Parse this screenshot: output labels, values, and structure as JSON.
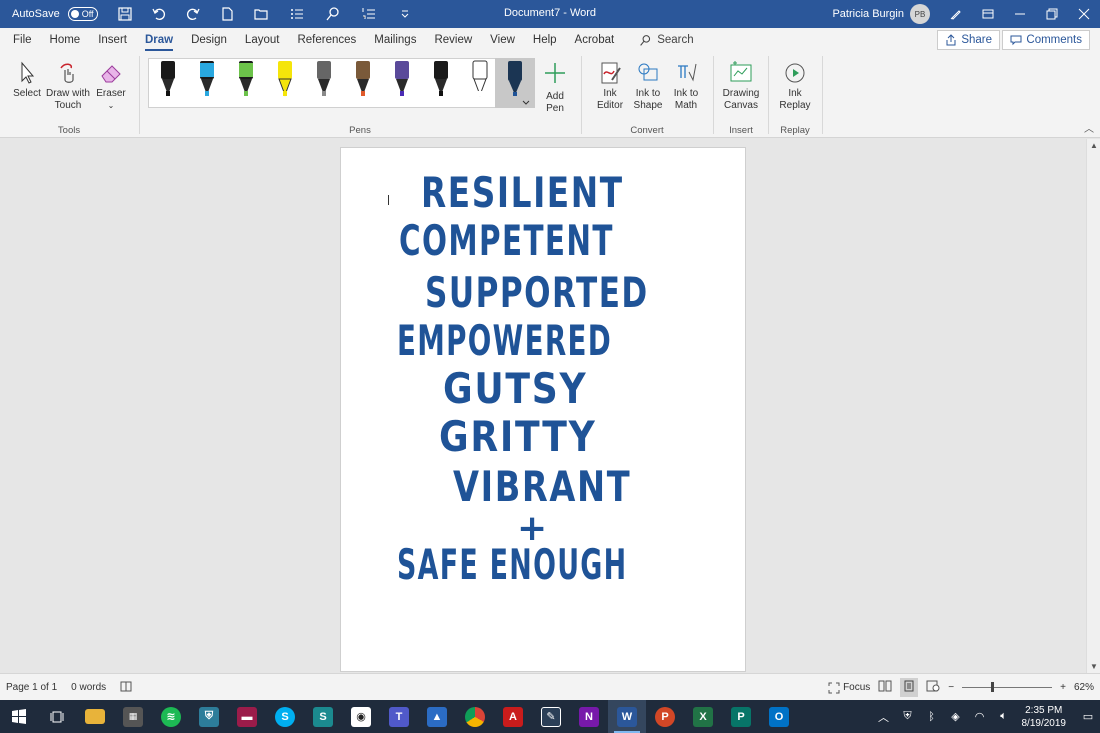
{
  "titlebar": {
    "autosave_label": "AutoSave",
    "autosave_state": "Off",
    "doc_title": "Document7  -  Word",
    "user_name": "Patricia Burgin",
    "user_initials": "PB"
  },
  "tabs": [
    {
      "label": "File"
    },
    {
      "label": "Home"
    },
    {
      "label": "Insert"
    },
    {
      "label": "Draw"
    },
    {
      "label": "Design"
    },
    {
      "label": "Layout"
    },
    {
      "label": "References"
    },
    {
      "label": "Mailings"
    },
    {
      "label": "Review"
    },
    {
      "label": "View"
    },
    {
      "label": "Help"
    },
    {
      "label": "Acrobat"
    }
  ],
  "active_tab": "Draw",
  "search_label": "Search",
  "share_label": "Share",
  "comments_label": "Comments",
  "ribbon": {
    "tools": {
      "group_label": "Tools",
      "select": "Select",
      "draw_touch_1": "Draw with",
      "draw_touch_2": "Touch",
      "eraser": "Eraser"
    },
    "pens": {
      "group_label": "Pens",
      "add_pen_1": "Add",
      "add_pen_2": "Pen",
      "colors": [
        "#111111",
        "#29a8e0",
        "#6cc24a",
        "#f5e50a",
        "#8a8a8a",
        "#e05a2b",
        "#4a2bb5",
        "#111111",
        "#ffffff",
        "#1f5397"
      ]
    },
    "convert": {
      "group_label": "Convert",
      "ink_editor_1": "Ink",
      "ink_editor_2": "Editor",
      "ink_shape_1": "Ink to",
      "ink_shape_2": "Shape",
      "ink_math_1": "Ink to",
      "ink_math_2": "Math"
    },
    "insert": {
      "group_label": "Insert",
      "canvas_1": "Drawing",
      "canvas_2": "Canvas"
    },
    "replay": {
      "group_label": "Replay",
      "ink_replay_1": "Ink",
      "ink_replay_2": "Replay"
    }
  },
  "document": {
    "ink_color": "#1f5397",
    "words": [
      "RESILIENT",
      "COMPETENT",
      "SUPPORTED",
      "EMPOWERED",
      "GUTSY",
      "GRITTY",
      "VIBRANT",
      "+",
      "SAFE ENOUGH"
    ]
  },
  "statusbar": {
    "page": "Page 1 of 1",
    "words": "0 words",
    "focus": "Focus",
    "zoom_minus": "−",
    "zoom_plus": "+",
    "zoom": "62%"
  },
  "taskbar": {
    "apps": [
      "start",
      "task-view",
      "file-explorer",
      "calculator",
      "spotify",
      "defender",
      "photos-app",
      "skype",
      "sway",
      "camera",
      "teams",
      "azure-data",
      "chrome",
      "acrobat",
      "whiteboard",
      "onenote",
      "word",
      "powerpoint",
      "excel",
      "publisher",
      "outlook"
    ],
    "time": "2:35 PM",
    "date": "8/19/2019"
  }
}
